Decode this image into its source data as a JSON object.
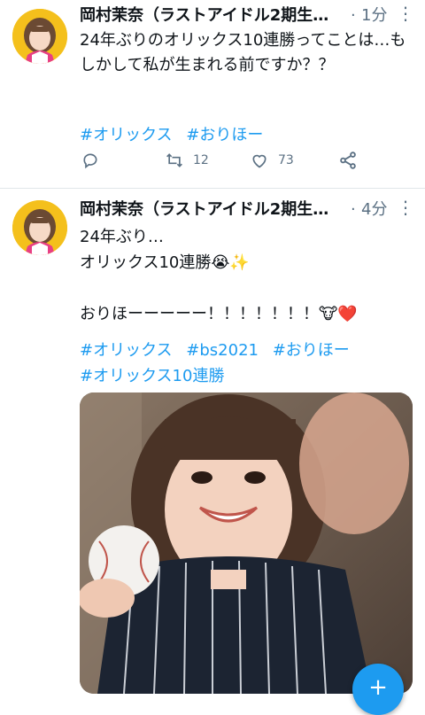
{
  "tweets": [
    {
      "display_name": "岡村茉奈（ラストアイドル2期生…",
      "separator": "·",
      "time": "1分",
      "text": "24年ぶりのオリックス10連勝ってことは…もしかして私が生まれる前ですか？？",
      "hashtags": [
        "#オリックス",
        "#おりほー"
      ],
      "reply_count": "",
      "retweet_count": "12",
      "like_count": "73"
    },
    {
      "display_name": "岡村茉奈（ラストアイドル2期生…",
      "separator": "·",
      "time": "4分",
      "text_line1": "24年ぶり…",
      "text_line2": "オリックス10連勝",
      "text_line3": "",
      "text_line4": "おりほーーーーー！！！！！！！",
      "hashtags_line1": [
        "#オリックス",
        "#bs2021",
        "#おりほー"
      ],
      "hashtags_line2": [
        "#オリックス10連勝"
      ]
    }
  ],
  "emoji": {
    "crying": "😭",
    "sparkles": "✨",
    "cow": "🐮",
    "heart": "❤️"
  },
  "icons": {
    "reply": "reply-icon",
    "retweet": "retweet-icon",
    "like": "heart-icon",
    "share": "share-icon",
    "more": "more-icon",
    "compose": "compose-icon"
  },
  "colors": {
    "hashtag": "#1d9bf0",
    "muted": "#5b7083",
    "fab": "#1d9bf0"
  }
}
